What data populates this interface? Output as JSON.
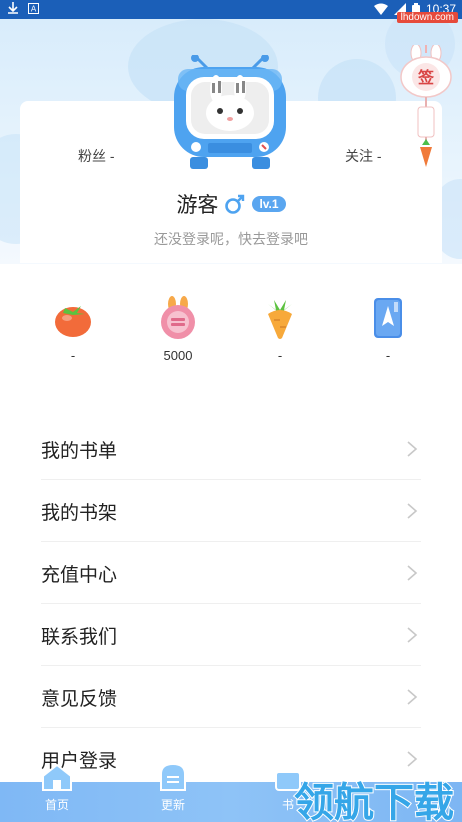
{
  "status_bar": {
    "time": "10:37"
  },
  "profile": {
    "fans_label": "粉丝 -",
    "follow_label": "关注 -",
    "username": "游客",
    "level": "lv.1",
    "login_hint": "还没登录呢，快去登录吧",
    "sign_in_label": "签"
  },
  "assets": [
    {
      "icon": "tomato-icon",
      "value": "-"
    },
    {
      "icon": "coin-bunny-icon",
      "value": "5000"
    },
    {
      "icon": "carrot-icon",
      "value": "-"
    },
    {
      "icon": "card-icon",
      "value": "-"
    }
  ],
  "menu": [
    {
      "label": "我的书单"
    },
    {
      "label": "我的书架"
    },
    {
      "label": "充值中心"
    },
    {
      "label": "联系我们"
    },
    {
      "label": "意见反馈"
    },
    {
      "label": "用户登录"
    }
  ],
  "bottom_nav": [
    {
      "label": "首页"
    },
    {
      "label": "更新"
    },
    {
      "label": "书"
    }
  ],
  "watermark": {
    "text": "领航下载",
    "url": "lhdown.com"
  },
  "colors": {
    "status_bar": "#1b5fb8",
    "accent": "#5aa6f0",
    "nav_bg": "#8ec3f7"
  }
}
